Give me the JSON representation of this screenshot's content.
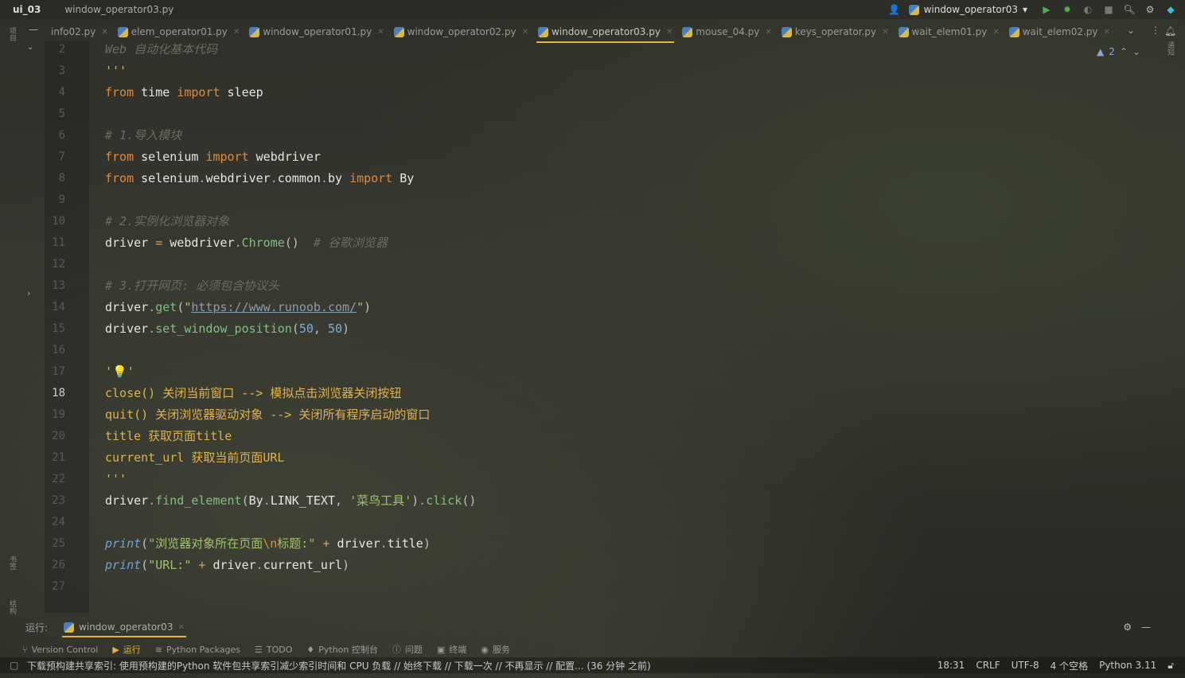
{
  "title_bar": {
    "project": "ui_03",
    "file": "window_operator03.py",
    "run_config": "window_operator03"
  },
  "tabs": [
    {
      "label": "info02.py",
      "active": false,
      "icon": false
    },
    {
      "label": "elem_operator01.py",
      "active": false,
      "icon": true
    },
    {
      "label": "window_operator01.py",
      "active": false,
      "icon": true
    },
    {
      "label": "window_operator02.py",
      "active": false,
      "icon": true
    },
    {
      "label": "window_operator03.py",
      "active": true,
      "icon": true
    },
    {
      "label": "mouse_04.py",
      "active": false,
      "icon": true
    },
    {
      "label": "keys_operator.py",
      "active": false,
      "icon": true
    },
    {
      "label": "wait_elem01.py",
      "active": false,
      "icon": true
    },
    {
      "label": "wait_elem02.py",
      "active": false,
      "icon": true
    }
  ],
  "inspections": {
    "warnings": "2"
  },
  "left_strip": {
    "project": "项目",
    "bookmarks": "书签",
    "structure": "结构"
  },
  "right_strip": {
    "notifications": "通知"
  },
  "code": {
    "current_line": "18",
    "lines": [
      {
        "n": "2",
        "seg": [
          [
            "cm",
            "Web 自动化基本代码"
          ]
        ]
      },
      {
        "n": "3",
        "seg": [
          [
            "ds",
            "'''"
          ]
        ]
      },
      {
        "n": "4",
        "seg": [
          [
            "kw",
            "from"
          ],
          [
            "id",
            " time "
          ],
          [
            "kw",
            "import"
          ],
          [
            "id",
            " sleep"
          ]
        ]
      },
      {
        "n": "5",
        "seg": []
      },
      {
        "n": "6",
        "seg": [
          [
            "cm",
            "# 1.导入模块"
          ]
        ]
      },
      {
        "n": "7",
        "seg": [
          [
            "kw",
            "from"
          ],
          [
            "id",
            " selenium "
          ],
          [
            "kw",
            "import"
          ],
          [
            "id",
            " webdriver"
          ]
        ]
      },
      {
        "n": "8",
        "seg": [
          [
            "kw",
            "from"
          ],
          [
            "id",
            " selenium"
          ],
          [
            "dot",
            "."
          ],
          [
            "id",
            "webdriver"
          ],
          [
            "dot",
            "."
          ],
          [
            "id",
            "common"
          ],
          [
            "dot",
            "."
          ],
          [
            "id",
            "by "
          ],
          [
            "kw",
            "import"
          ],
          [
            "id",
            " By"
          ]
        ]
      },
      {
        "n": "9",
        "seg": []
      },
      {
        "n": "10",
        "seg": [
          [
            "cm",
            "# 2.实例化浏览器对象"
          ]
        ]
      },
      {
        "n": "11",
        "seg": [
          [
            "id",
            "driver "
          ],
          [
            "op",
            "="
          ],
          [
            "id",
            " webdriver"
          ],
          [
            "dot",
            "."
          ],
          [
            "fn",
            "Chrome"
          ],
          [
            "pn",
            "()  "
          ],
          [
            "cm",
            "# 谷歌浏览器"
          ]
        ]
      },
      {
        "n": "12",
        "seg": []
      },
      {
        "n": "13",
        "seg": [
          [
            "cm",
            "# 3.打开网页: 必须包含协议头"
          ]
        ]
      },
      {
        "n": "14",
        "seg": [
          [
            "id",
            "driver"
          ],
          [
            "dot",
            "."
          ],
          [
            "fn",
            "get"
          ],
          [
            "pn",
            "("
          ],
          [
            "st",
            "\""
          ],
          [
            "url",
            "https://www.runoob.com/"
          ],
          [
            "st",
            "\""
          ],
          [
            "pn",
            ")"
          ]
        ]
      },
      {
        "n": "15",
        "seg": [
          [
            "id",
            "driver"
          ],
          [
            "dot",
            "."
          ],
          [
            "fn",
            "set_window_position"
          ],
          [
            "pn",
            "("
          ],
          [
            "num",
            "50"
          ],
          [
            "pn",
            ", "
          ],
          [
            "num",
            "50"
          ],
          [
            "pn",
            ")"
          ]
        ]
      },
      {
        "n": "16",
        "seg": []
      },
      {
        "n": "17",
        "seg": [
          [
            "ds",
            "'💡'"
          ]
        ]
      },
      {
        "n": "18",
        "seg": [
          [
            "ds",
            "close() 关闭当前窗口 --> 模拟点击浏览器关闭按钮"
          ]
        ]
      },
      {
        "n": "19",
        "seg": [
          [
            "ds",
            "quit() 关闭浏览器驱动对象 --> 关闭所有程序启动的窗口"
          ]
        ]
      },
      {
        "n": "20",
        "seg": [
          [
            "ds",
            "title 获取页面title"
          ]
        ]
      },
      {
        "n": "21",
        "seg": [
          [
            "ds",
            "current_url 获取当前页面URL"
          ]
        ]
      },
      {
        "n": "22",
        "seg": [
          [
            "ds",
            "'''"
          ]
        ]
      },
      {
        "n": "23",
        "seg": [
          [
            "id",
            "driver"
          ],
          [
            "dot",
            "."
          ],
          [
            "fn",
            "find_element"
          ],
          [
            "pn",
            "("
          ],
          [
            "id",
            "By"
          ],
          [
            "dot",
            "."
          ],
          [
            "id",
            "LINK_TEXT"
          ],
          [
            "pn",
            ", "
          ],
          [
            "st",
            "'菜鸟工具'"
          ],
          [
            "pn",
            ")"
          ],
          [
            "dot",
            "."
          ],
          [
            "fn",
            "click"
          ],
          [
            "pn",
            "()"
          ]
        ]
      },
      {
        "n": "24",
        "seg": []
      },
      {
        "n": "25",
        "seg": [
          [
            "bi",
            "print"
          ],
          [
            "pn",
            "("
          ],
          [
            "st",
            "\"浏览器对象所在页面"
          ],
          [
            "kw",
            "\\n"
          ],
          [
            "st",
            "标题:\""
          ],
          [
            "op",
            " + "
          ],
          [
            "id",
            "driver"
          ],
          [
            "dot",
            "."
          ],
          [
            "id",
            "title"
          ],
          [
            "pn",
            ")"
          ]
        ]
      },
      {
        "n": "26",
        "seg": [
          [
            "bi",
            "print"
          ],
          [
            "pn",
            "("
          ],
          [
            "st",
            "\"URL:\""
          ],
          [
            "op",
            " + "
          ],
          [
            "id",
            "driver"
          ],
          [
            "dot",
            "."
          ],
          [
            "id",
            "current_url"
          ],
          [
            "pn",
            ")"
          ]
        ]
      },
      {
        "n": "27",
        "seg": []
      }
    ]
  },
  "run_panel": {
    "label": "运行:",
    "tab": "window_operator03"
  },
  "tool_windows": [
    "Version Control",
    "运行",
    "Python Packages",
    "TODO",
    "Python 控制台",
    "问题",
    "终端",
    "服务"
  ],
  "status_bar": {
    "message": "下载预构建共享索引: 使用预构建的Python 软件包共享索引减少索引时间和 CPU 负载 // 始终下载 // 下载一次 // 不再显示 // 配置... (36 分钟 之前)",
    "position": "18:31",
    "line_sep": "CRLF",
    "encoding": "UTF-8",
    "indent": "4 个空格",
    "interpreter": "Python 3.11"
  },
  "colors": {
    "accent": "#e0b34c",
    "run": "#4caf50",
    "keyword": "#e08a3c"
  }
}
